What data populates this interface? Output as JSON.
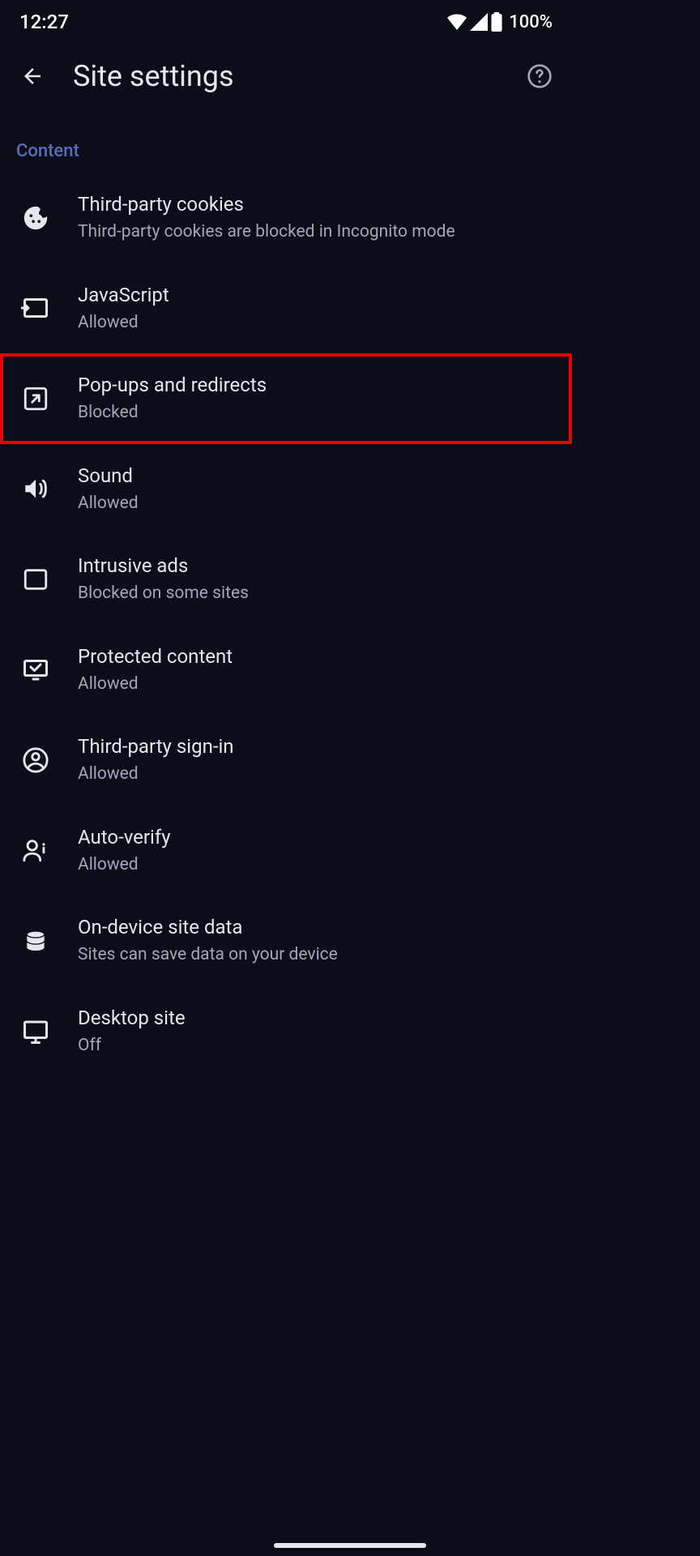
{
  "status": {
    "time": "12:27",
    "battery": "100%"
  },
  "header": {
    "title": "Site settings"
  },
  "section": {
    "label": "Content"
  },
  "items": [
    {
      "title": "Third-party cookies",
      "sub": "Third-party cookies are blocked in Incognito mode"
    },
    {
      "title": "JavaScript",
      "sub": "Allowed"
    },
    {
      "title": "Pop-ups and redirects",
      "sub": "Blocked"
    },
    {
      "title": "Sound",
      "sub": "Allowed"
    },
    {
      "title": "Intrusive ads",
      "sub": "Blocked on some sites"
    },
    {
      "title": "Protected content",
      "sub": "Allowed"
    },
    {
      "title": "Third-party sign-in",
      "sub": "Allowed"
    },
    {
      "title": "Auto-verify",
      "sub": "Allowed"
    },
    {
      "title": "On-device site data",
      "sub": "Sites can save data on your device"
    },
    {
      "title": "Desktop site",
      "sub": "Off"
    }
  ]
}
